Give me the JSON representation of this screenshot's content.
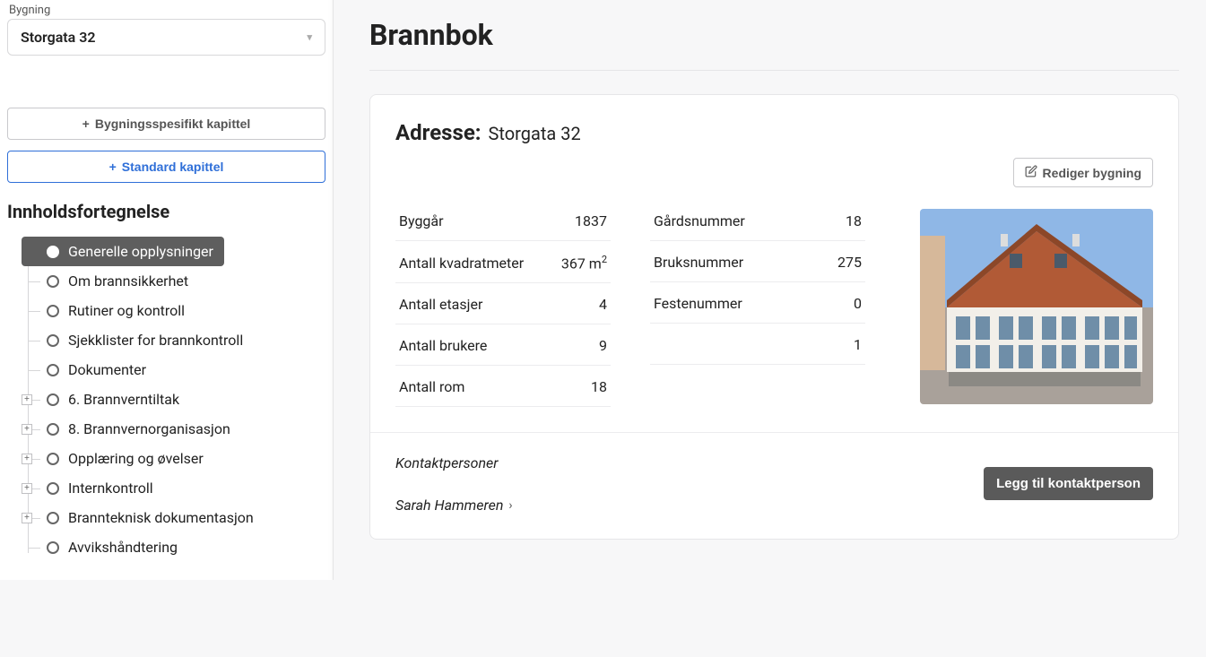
{
  "sidebar": {
    "building_label": "Bygning",
    "building_selected": "Storgata 32",
    "btn_specific": "Bygningsspesifikt kapittel",
    "btn_standard": "Standard kapittel",
    "toc_title": "Innholdsfortegnelse",
    "items": [
      {
        "label": "Generelle opplysninger",
        "active": true,
        "expandable": false
      },
      {
        "label": "Om brannsikkerhet",
        "active": false,
        "expandable": false
      },
      {
        "label": "Rutiner og kontroll",
        "active": false,
        "expandable": false
      },
      {
        "label": "Sjekklister for brannkontroll",
        "active": false,
        "expandable": false
      },
      {
        "label": "Dokumenter",
        "active": false,
        "expandable": false
      },
      {
        "label": "6. Brannverntiltak",
        "active": false,
        "expandable": true
      },
      {
        "label": "8. Brannvernorganisasjon",
        "active": false,
        "expandable": true
      },
      {
        "label": "Opplæring og øvelser",
        "active": false,
        "expandable": true
      },
      {
        "label": "Internkontroll",
        "active": false,
        "expandable": true
      },
      {
        "label": "Brannteknisk dokumentasjon",
        "active": false,
        "expandable": true
      },
      {
        "label": "Avvikshåndtering",
        "active": false,
        "expandable": false
      }
    ]
  },
  "main": {
    "title": "Brannbok",
    "address_label": "Adresse:",
    "address_value": "Storgata 32",
    "edit_label": "Rediger bygning",
    "properties_left": [
      {
        "k": "Byggår",
        "v": "1837"
      },
      {
        "k": "Antall kvadratmeter",
        "v": "367 m",
        "sup": "2"
      },
      {
        "k": "Antall etasjer",
        "v": "4"
      },
      {
        "k": "Antall brukere",
        "v": "9"
      },
      {
        "k": "Antall rom",
        "v": "18"
      }
    ],
    "properties_right": [
      {
        "k": "Gårdsnummer",
        "v": "18"
      },
      {
        "k": "Bruksnummer",
        "v": "275"
      },
      {
        "k": "Festenummer",
        "v": "0"
      },
      {
        "k": "",
        "v": "1"
      }
    ],
    "contacts_title": "Kontaktpersoner",
    "contacts": [
      {
        "name": "Sarah Hammeren"
      }
    ],
    "add_contact_label": "Legg til kontaktperson"
  }
}
